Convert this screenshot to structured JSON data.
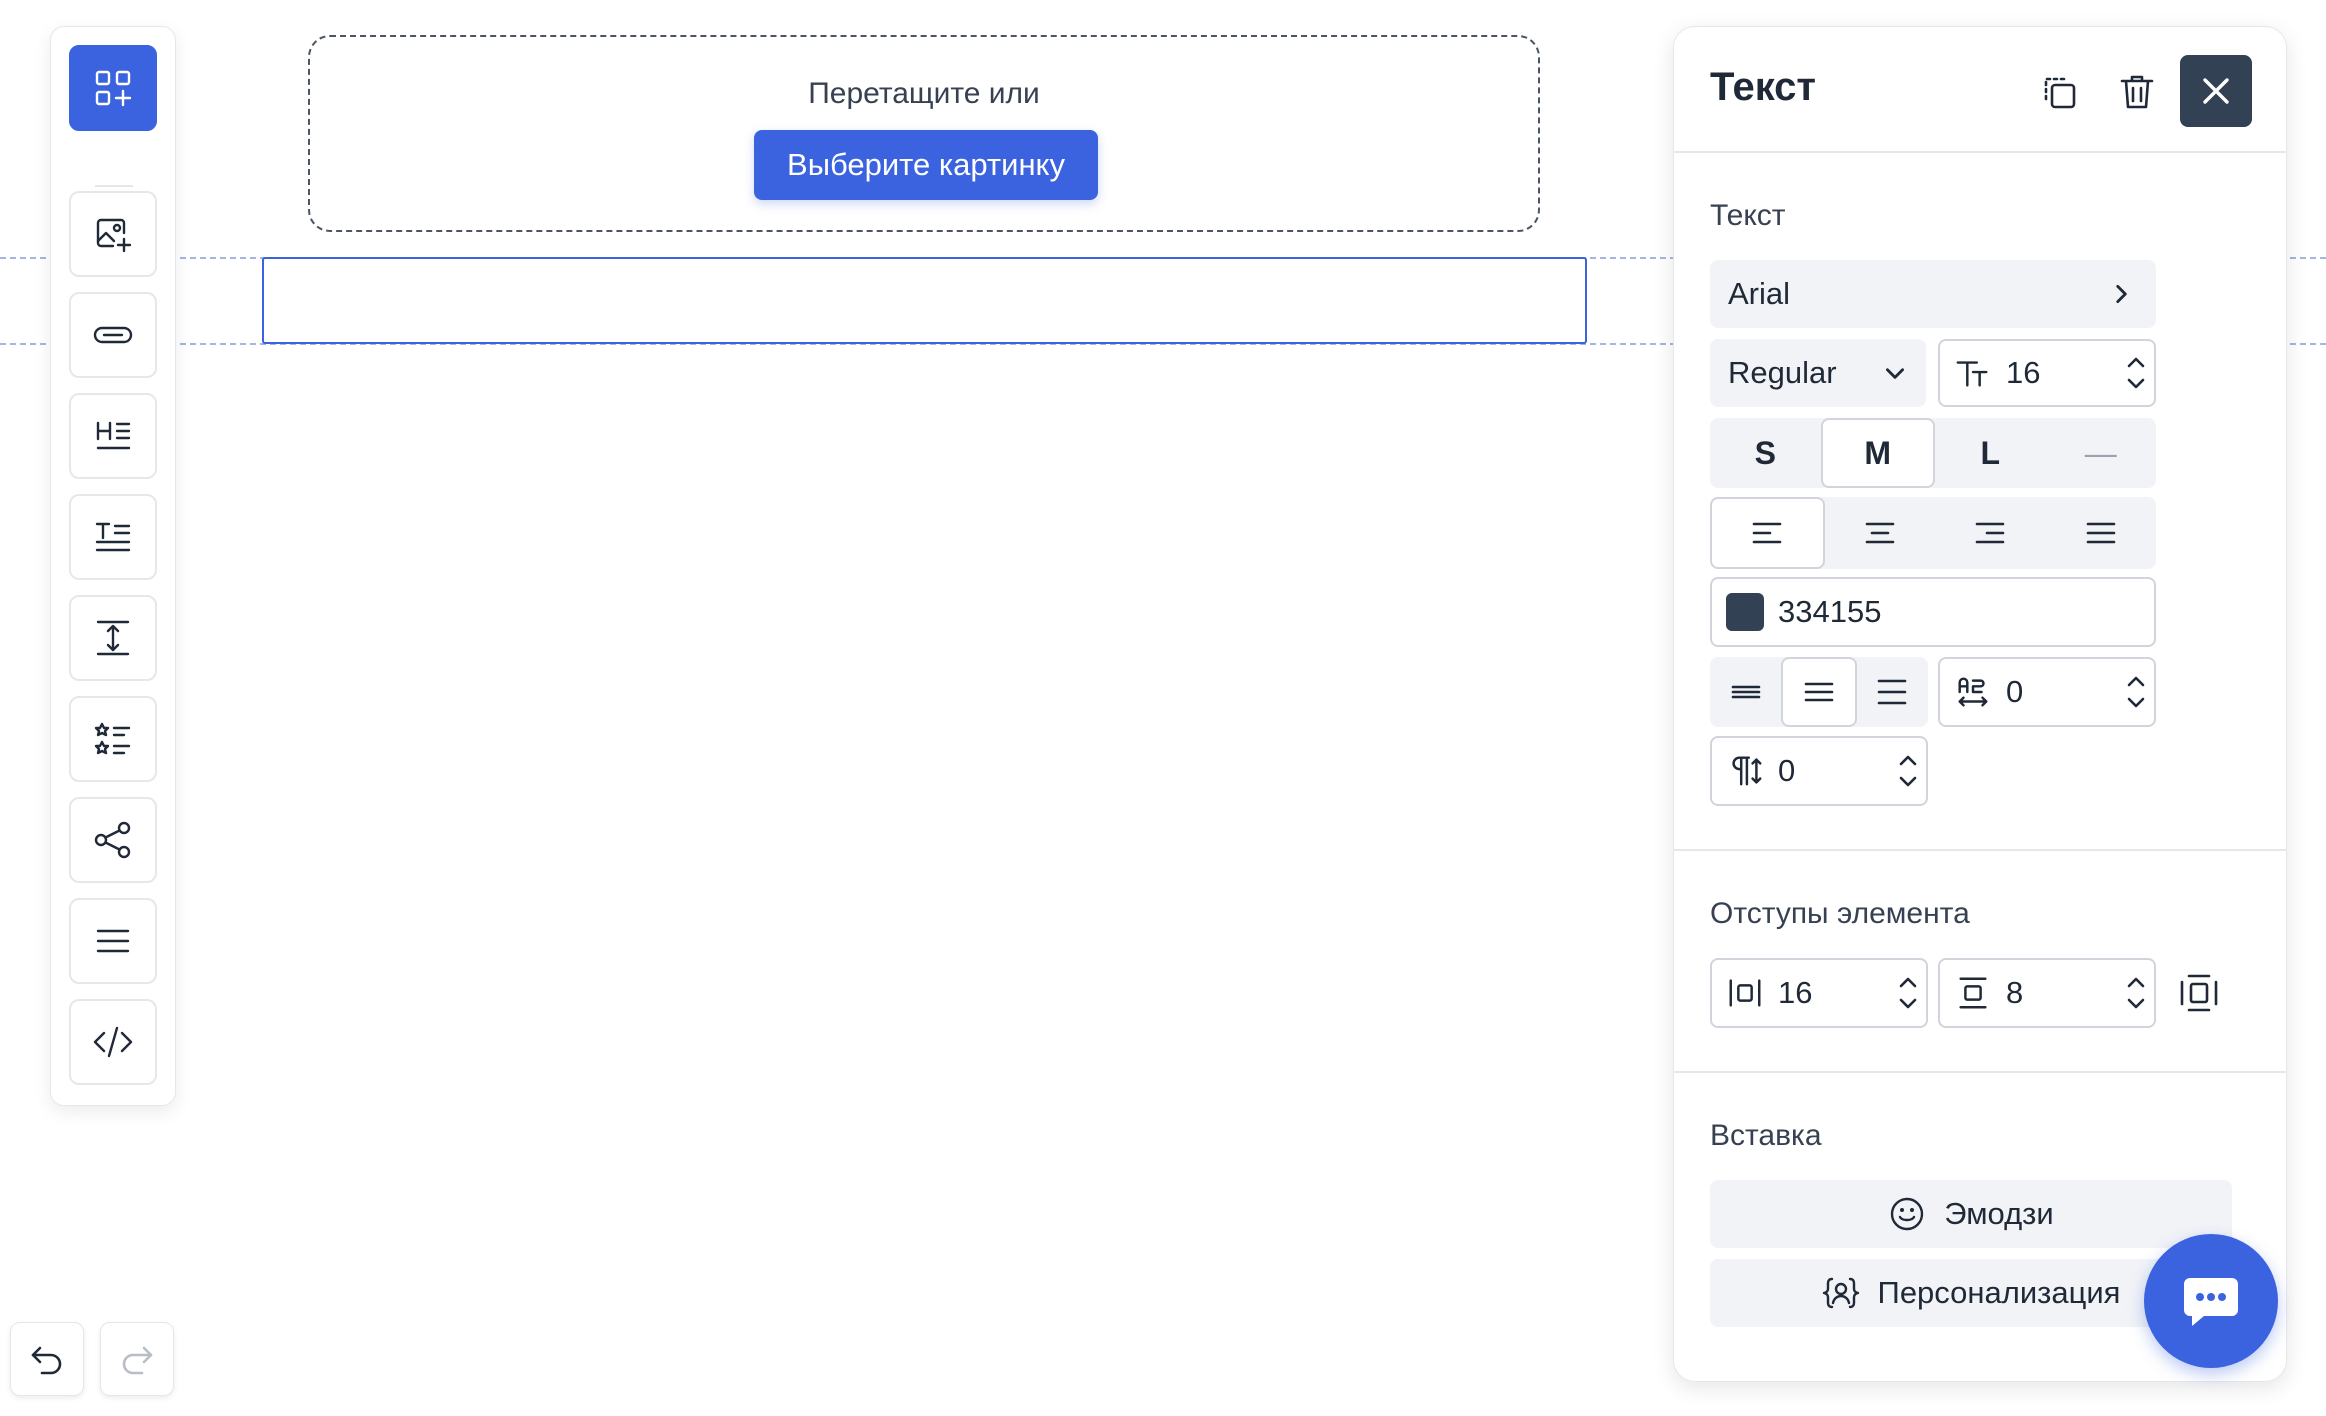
{
  "canvas": {
    "dropzone_text": "Перетащите или",
    "choose_button": "Выберите картинку"
  },
  "toolbar": {
    "items": [
      "blocks-add-icon",
      "image-add-icon",
      "button-icon",
      "heading-icon",
      "text-icon",
      "spacer-icon",
      "list-icon",
      "social-icon",
      "menu-icon",
      "html-icon"
    ]
  },
  "panel": {
    "title": "Текст",
    "text_section": "Текст",
    "font_family": "Arial",
    "font_weight": "Regular",
    "font_size": "16",
    "sizes": [
      "S",
      "M",
      "L",
      "—"
    ],
    "selected_size": "M",
    "color_value": "334155",
    "color_swatch": "#334155",
    "letter_spacing": "0",
    "paragraph_spacing": "0",
    "padding_section": "Отступы элемента",
    "padding_horizontal": "16",
    "padding_vertical": "8",
    "insert_section": "Вставка",
    "emoji_label": "Эмодзи",
    "personalization_label": "Персонализация"
  },
  "colors": {
    "accent": "#3b63e0",
    "dark": "#334155"
  }
}
